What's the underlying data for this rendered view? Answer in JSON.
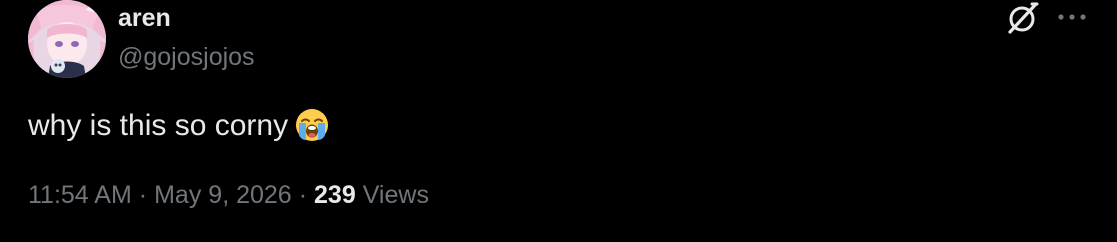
{
  "author": {
    "display_name": "aren",
    "handle": "@gojosjojo s"
  },
  "tweet": {
    "text": "why is this so corny",
    "emoji": "loudly-crying-face"
  },
  "meta": {
    "time": "11:54 AM",
    "separator": "·",
    "date": "May 9, 2026",
    "views_count": "239",
    "views_label": "Views"
  },
  "icons": {
    "grok": "grok-icon",
    "more": "more-icon"
  },
  "colors": {
    "background": "#000000",
    "primary_text": "#e7e9ea",
    "secondary_text": "#71767b"
  }
}
